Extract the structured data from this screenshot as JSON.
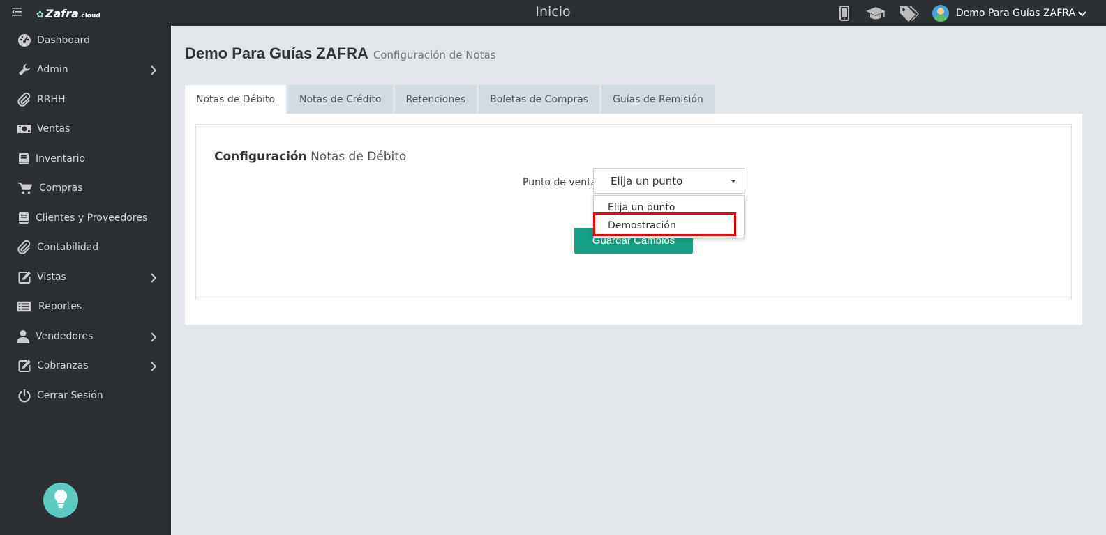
{
  "app": {
    "logo_text": "Zafra",
    "logo_suffix": ".cloud",
    "page_title": "Inicio"
  },
  "header": {
    "user_name": "Demo Para Guías ZAFRA",
    "icons": [
      "mobile-icon",
      "graduation-cap-icon",
      "tags-icon"
    ]
  },
  "sidebar": {
    "items": [
      {
        "label": "Dashboard",
        "icon": "dashboard-icon",
        "has_submenu": false
      },
      {
        "label": "Admin",
        "icon": "wrench-icon",
        "has_submenu": true
      },
      {
        "label": "RRHH",
        "icon": "paperclip-icon",
        "has_submenu": false
      },
      {
        "label": "Ventas",
        "icon": "money-icon",
        "has_submenu": false
      },
      {
        "label": "Inventario",
        "icon": "book-icon",
        "has_submenu": false
      },
      {
        "label": "Compras",
        "icon": "cart-icon",
        "has_submenu": false
      },
      {
        "label": "Clientes y Proveedores",
        "icon": "book-icon",
        "has_submenu": false
      },
      {
        "label": "Contabilidad",
        "icon": "paperclip-icon",
        "has_submenu": false
      },
      {
        "label": "Vistas",
        "icon": "edit-icon",
        "has_submenu": true
      },
      {
        "label": "Reportes",
        "icon": "list-icon",
        "has_submenu": false
      },
      {
        "label": "Vendedores",
        "icon": "user-icon",
        "has_submenu": true
      },
      {
        "label": "Cobranzas",
        "icon": "edit-icon",
        "has_submenu": true
      },
      {
        "label": "Cerrar Sesión",
        "icon": "power-icon",
        "has_submenu": false
      }
    ]
  },
  "main": {
    "title": "Demo Para Guías ZAFRA",
    "subtitle": "Configuración de Notas",
    "tabs": [
      {
        "label": "Notas de Débito",
        "active": true
      },
      {
        "label": "Notas de Crédito",
        "active": false
      },
      {
        "label": "Retenciones",
        "active": false
      },
      {
        "label": "Boletas de Compras",
        "active": false
      },
      {
        "label": "Guías de Remisión",
        "active": false
      }
    ],
    "config_title_bold": "Configuración",
    "config_title_rest": "Notas de Débito",
    "field_label": "Punto de venta",
    "select_value": "Elija un punto",
    "dropdown_options": [
      "Elija un punto",
      "Demostración"
    ],
    "save_label": "Guardar Cambios"
  },
  "colors": {
    "sidebar_bg": "#2b2f33",
    "accent": "#16a085",
    "highlight": "#ee0000",
    "help_bubble": "#5ec9c0"
  }
}
